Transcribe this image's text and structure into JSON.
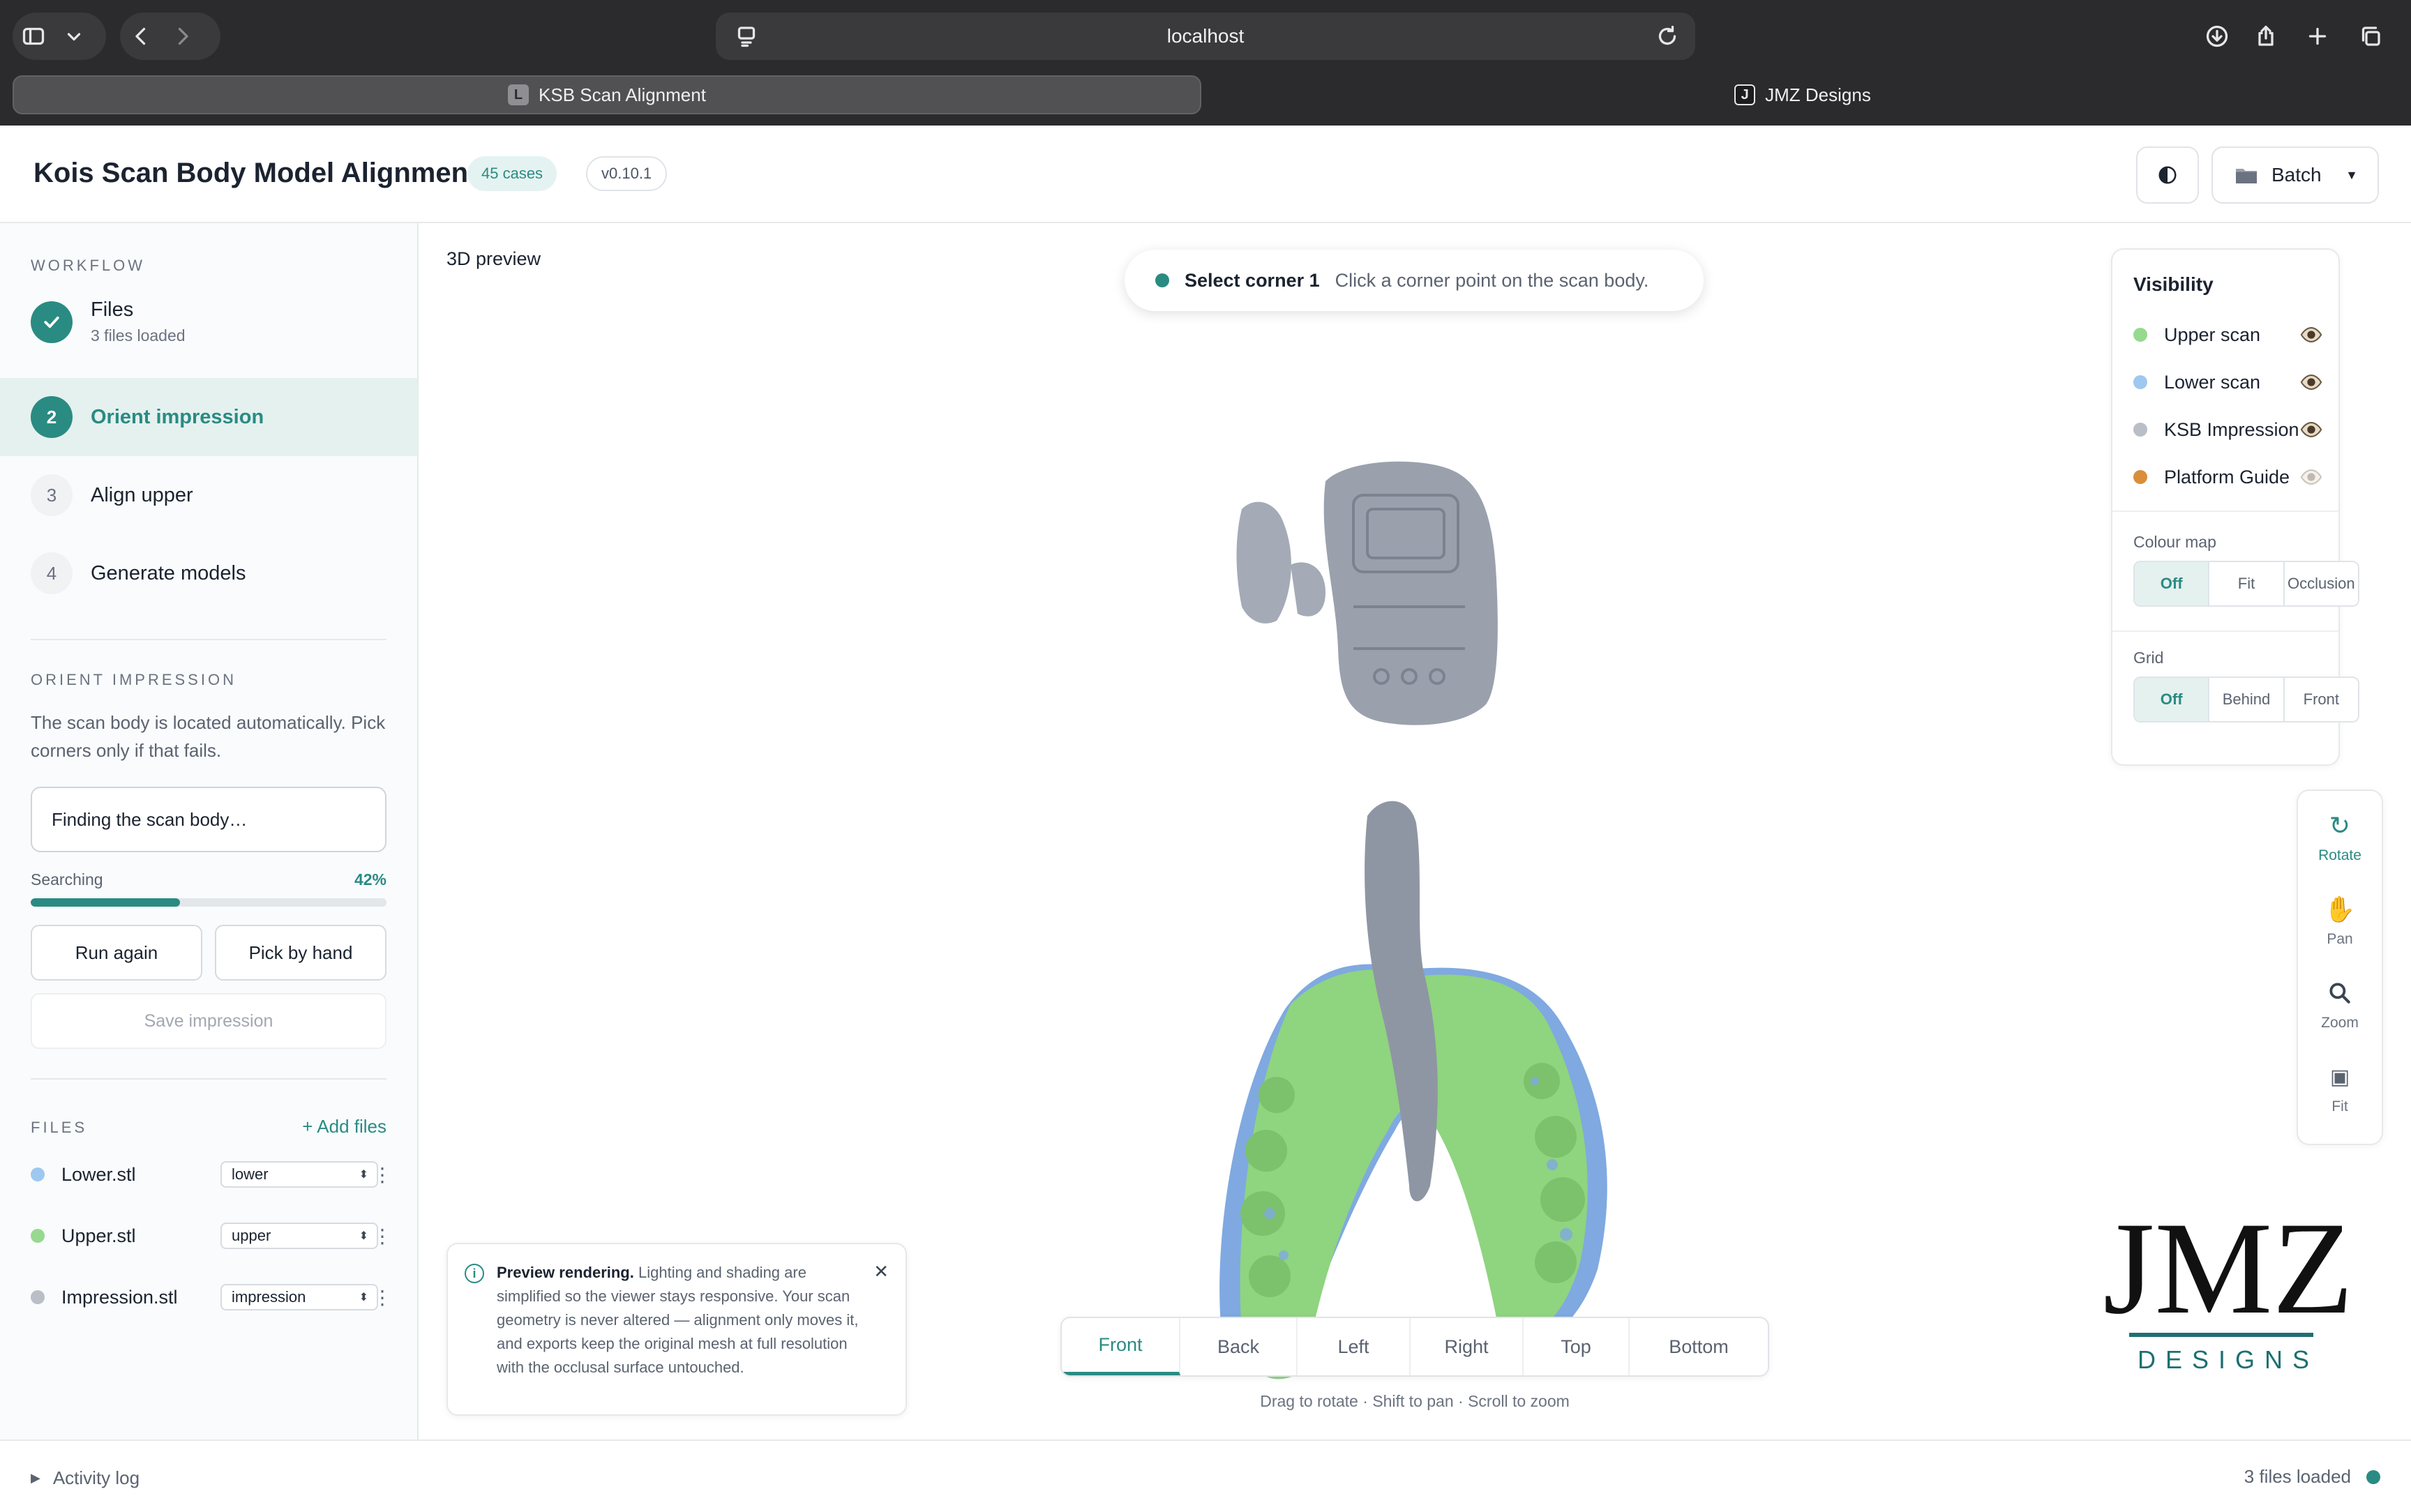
{
  "browser": {
    "url": "localhost",
    "tabs": [
      {
        "label": "KSB Scan Alignment",
        "favicon": "L"
      },
      {
        "label": "JMZ Designs",
        "favicon": "J"
      }
    ]
  },
  "header": {
    "title": "Kois Scan Body Model Alignment",
    "cases_badge": "45 cases",
    "version_badge": "v0.10.1",
    "batch_label": "Batch"
  },
  "sidebar": {
    "workflow_label": "WORKFLOW",
    "steps": [
      {
        "number": "1",
        "title": "Files",
        "subtitle": "3 files loaded",
        "state": "done"
      },
      {
        "number": "2",
        "title": "Orient impression",
        "state": "current"
      },
      {
        "number": "3",
        "title": "Align upper",
        "state": "pending"
      },
      {
        "number": "4",
        "title": "Generate models",
        "state": "pending"
      }
    ],
    "orient": {
      "label": "ORIENT IMPRESSION",
      "description": "The scan body is located automatically. Pick corners only if that fails.",
      "status": "Finding the scan body…",
      "progress_label": "Searching",
      "progress_text": "42%",
      "progress_value": 0.42,
      "run_again": "Run again",
      "pick_by_hand": "Pick by hand",
      "save": "Save impression"
    },
    "files": {
      "label": "FILES",
      "add": "+ Add files",
      "items": [
        {
          "name": "Lower.stl",
          "role": "lower",
          "color": "#9ec8ef"
        },
        {
          "name": "Upper.stl",
          "role": "upper",
          "color": "#97d98f"
        },
        {
          "name": "Impression.stl",
          "role": "impression",
          "color": "#b9bec7"
        }
      ]
    }
  },
  "viewer": {
    "label": "3D preview",
    "banner": {
      "title": "Select corner 1",
      "text": "Click a corner point on the scan body."
    },
    "visibility": {
      "title": "Visibility",
      "layers": [
        {
          "name": "Upper scan",
          "color": "#97d98f",
          "visible": true
        },
        {
          "name": "Lower scan",
          "color": "#9ec8ef",
          "visible": true
        },
        {
          "name": "KSB Impression",
          "color": "#b9bec7",
          "visible": true
        },
        {
          "name": "Platform Guide",
          "color": "#d98e3a",
          "visible": false
        }
      ],
      "colour_map_label": "Colour map",
      "colour_map_options": [
        "Off",
        "Fit",
        "Occlusion"
      ],
      "colour_map_selected": "Off",
      "grid_label": "Grid",
      "grid_options": [
        "Off",
        "Behind",
        "Front"
      ],
      "grid_selected": "Off"
    },
    "tools": [
      {
        "label": "Rotate",
        "icon": "rotate-icon",
        "glyph": "↻"
      },
      {
        "label": "Pan",
        "icon": "hand-icon",
        "glyph": "✋"
      },
      {
        "label": "Zoom",
        "icon": "magnifier-icon",
        "glyph": "🔍"
      },
      {
        "label": "Fit",
        "icon": "fit-icon",
        "glyph": "▣"
      }
    ],
    "info": {
      "title": "Preview rendering.",
      "text": "Lighting and shading are simplified so the viewer stays responsive. Your scan geometry is never altered — alignment only moves it, and exports keep the original mesh at full resolution with the occlusal surface untouched."
    },
    "views": [
      "Front",
      "Back",
      "Left",
      "Right",
      "Top",
      "Bottom"
    ],
    "selected_view": "Front",
    "hint": "Drag to rotate · Shift to pan · Scroll to zoom",
    "logo": {
      "mark": "JMZ",
      "sub": "DESIGNS"
    }
  },
  "footer": {
    "activity_log": "Activity log",
    "status": "3 files loaded"
  },
  "colors": {
    "accent": "#2a8b83",
    "upper": "#97d98f",
    "lower": "#9ec8ef",
    "impression": "#b9bec7",
    "guide": "#d98e3a"
  }
}
